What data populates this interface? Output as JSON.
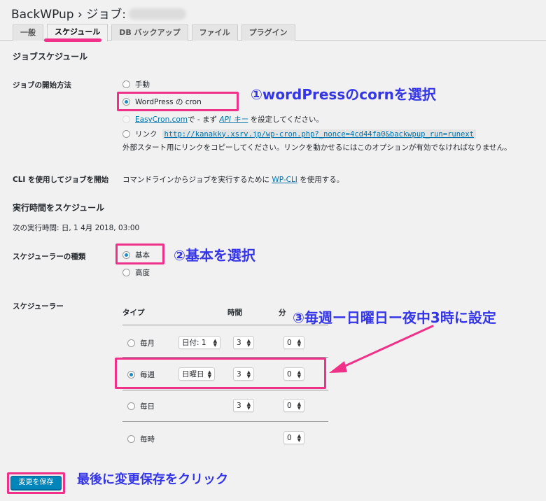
{
  "page": {
    "title": "BackWPup › ジョブ:"
  },
  "tabs": [
    {
      "label": "一般"
    },
    {
      "label": "スケジュール"
    },
    {
      "label": "DB バックアップ"
    },
    {
      "label": "ファイル"
    },
    {
      "label": "プラグイン"
    }
  ],
  "job_schedule": {
    "heading": "ジョブスケジュール",
    "start_method_label": "ジョブの開始方法",
    "options": {
      "manual": "手動",
      "wp_cron": "WordPress の cron",
      "easycron_link": "EasyCron.com",
      "easycron_mid": "で - まず",
      "api_key_link": "API キー",
      "easycron_tail": "を設定してください。",
      "link": "リンク",
      "link_url": "http://kanakky.xsrv.jp/wp-cron.php?_nonce=4cd44fa0&backwpup_run=runext",
      "link_help": "外部スタート用にリンクをコピーしてください。リンクを動かせるにはこのオプションが有効でなければなりません。"
    },
    "cli_label": "CLI を使用してジョブを開始",
    "cli_text_pre": "コマンドラインからジョブを実行するために",
    "cli_link": "WP-CLI",
    "cli_text_post": "を使用する。"
  },
  "run_time": {
    "heading": "実行時間をスケジュール",
    "next_run": "次の実行時間: 日, 1 4月 2018, 03:00",
    "scheduler_type_label": "スケジューラーの種類",
    "type_basic": "基本",
    "type_advanced": "高度",
    "scheduler_label": "スケジューラー"
  },
  "scheduler_table": {
    "col_type": "タイプ",
    "col_hour": "時間",
    "col_min": "分",
    "rows": [
      {
        "label": "毎月",
        "day": "日付: 1",
        "hour": "3",
        "min": "0"
      },
      {
        "label": "毎週",
        "day": "日曜日",
        "hour": "3",
        "min": "0"
      },
      {
        "label": "毎日",
        "hour": "3",
        "min": "0"
      },
      {
        "label": "毎時",
        "min": "0"
      }
    ]
  },
  "save_button": "変更を保存",
  "annotations": {
    "a1": "①wordPressのcornを選択",
    "a2": "②基本を選択",
    "a3": "③毎週ー日曜日ー夜中3時に設定",
    "a4": "最後に変更保存をクリック"
  },
  "colors": {
    "highlight": "#f0318a",
    "annotation_text": "#3535e8",
    "primary_button": "#0085ba",
    "link": "#0073aa"
  }
}
